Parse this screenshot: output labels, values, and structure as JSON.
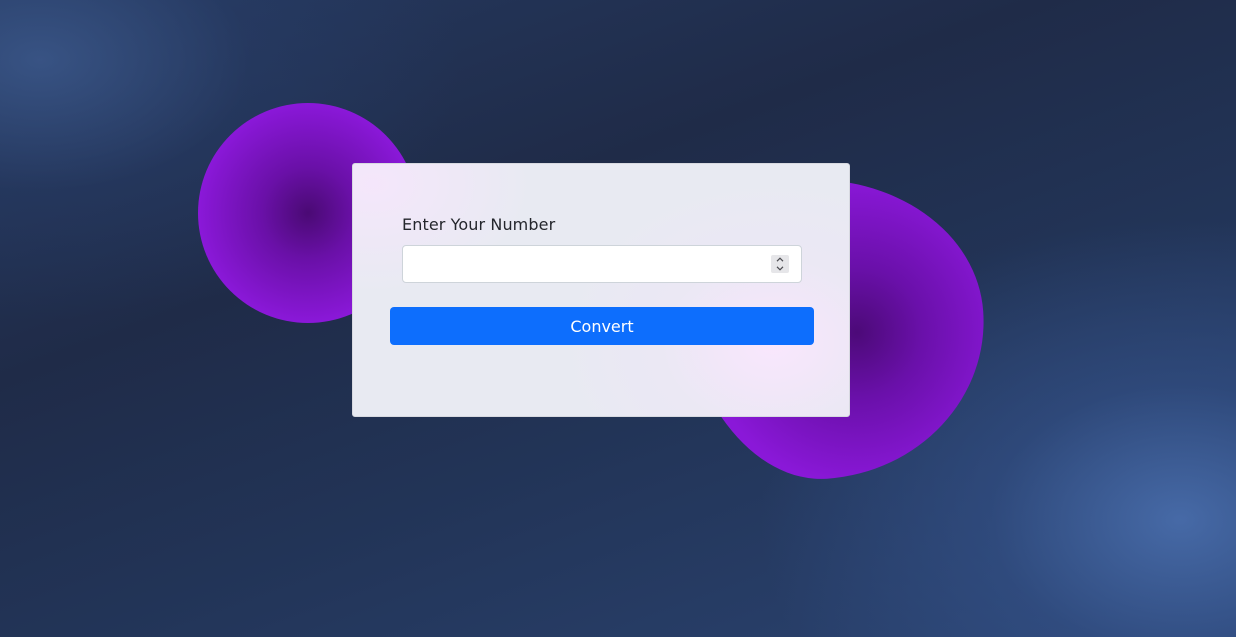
{
  "form": {
    "label": "Enter Your Number",
    "input_value": "",
    "input_placeholder": "",
    "spinner_up_icon": "chevron-up-icon",
    "spinner_down_icon": "chevron-down-icon",
    "submit_label": "Convert"
  },
  "colors": {
    "accent": "#0d6efd",
    "blob": "#8a18d8",
    "background": "#1f2b48",
    "card": "#e8eaf2"
  }
}
